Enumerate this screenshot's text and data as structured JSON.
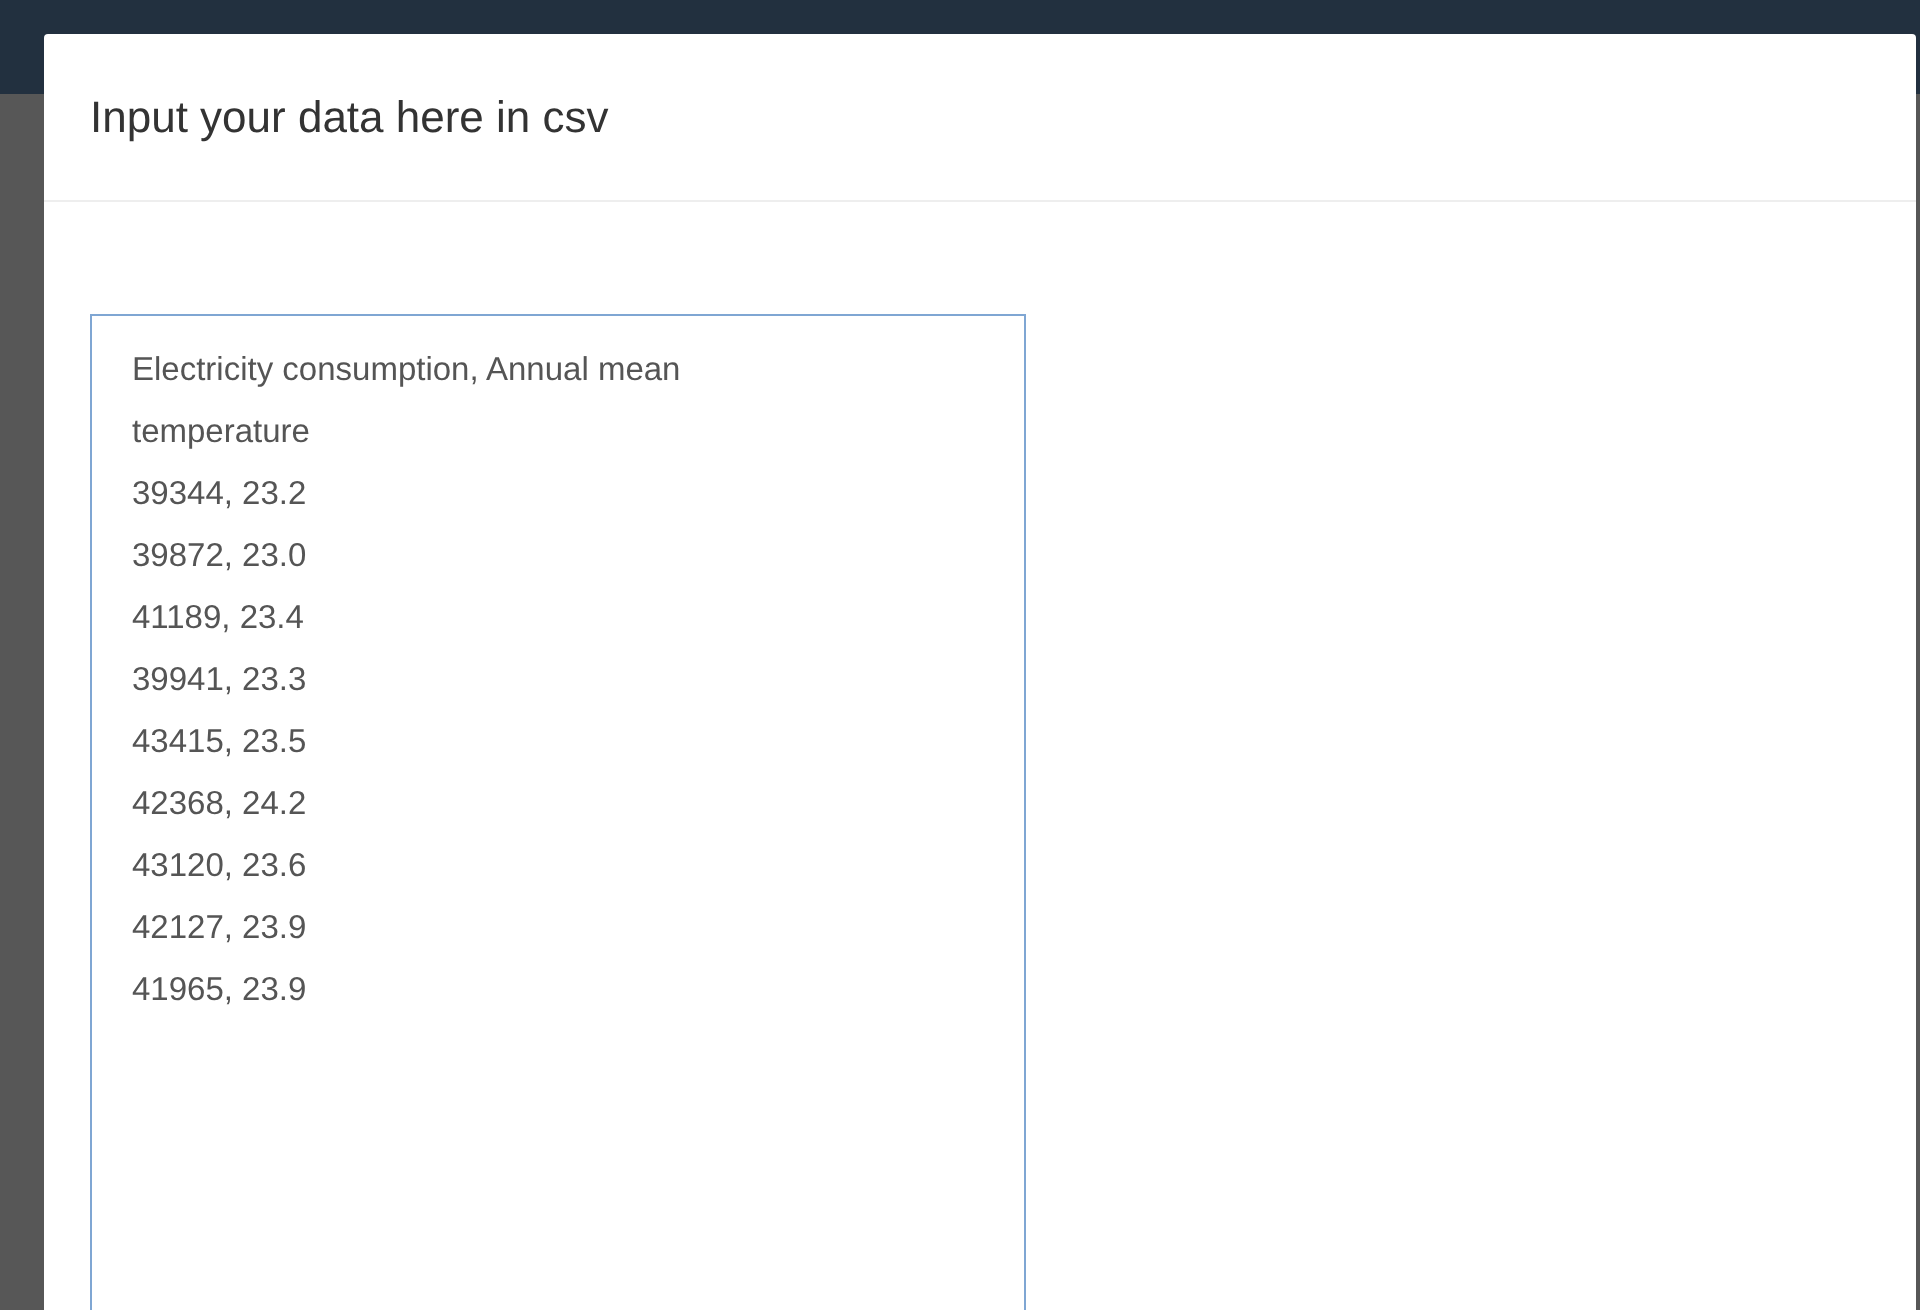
{
  "modal": {
    "title": "Input your data here in csv",
    "csv_field": {
      "lines": [
        "Electricity consumption, Annual mean temperature",
        "39344, 23.2",
        "39872, 23.0",
        "41189, 23.4",
        "39941, 23.3",
        "43415, 23.5",
        "42368, 24.2",
        "43120, 23.6",
        "42127, 23.9",
        "41965, 23.9"
      ]
    }
  }
}
